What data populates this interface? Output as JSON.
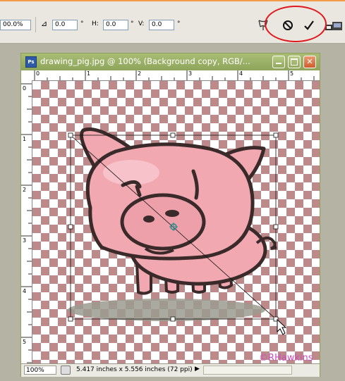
{
  "options_bar": {
    "width_value": "00.0%",
    "angle_value": "0.0",
    "angle_unit": "°",
    "h_label": "H:",
    "h_value": "0.0",
    "h_unit": "°",
    "v_label": "V:",
    "v_value": "0.0",
    "v_unit": "°"
  },
  "document": {
    "title": "drawing_pig.jpg @ 100% (Background copy, RGB/...",
    "ps_badge": "Ps",
    "ruler_h_ticks": [
      "0",
      "1",
      "2",
      "3",
      "4",
      "5"
    ],
    "ruler_v_ticks": [
      "0",
      "1",
      "2",
      "3",
      "4",
      "5"
    ],
    "zoom": "100%",
    "doc_info": "5.417 inches x 5.556 inches (72 ppi)"
  },
  "watermark": "©RHawkins",
  "colors": {
    "annotation_circle": "#e0191e",
    "title_bar": "#9bb067",
    "checker": "#bc8a8a",
    "pig_pink": "#f2a8b1",
    "watermark": "#cc4fc0"
  }
}
